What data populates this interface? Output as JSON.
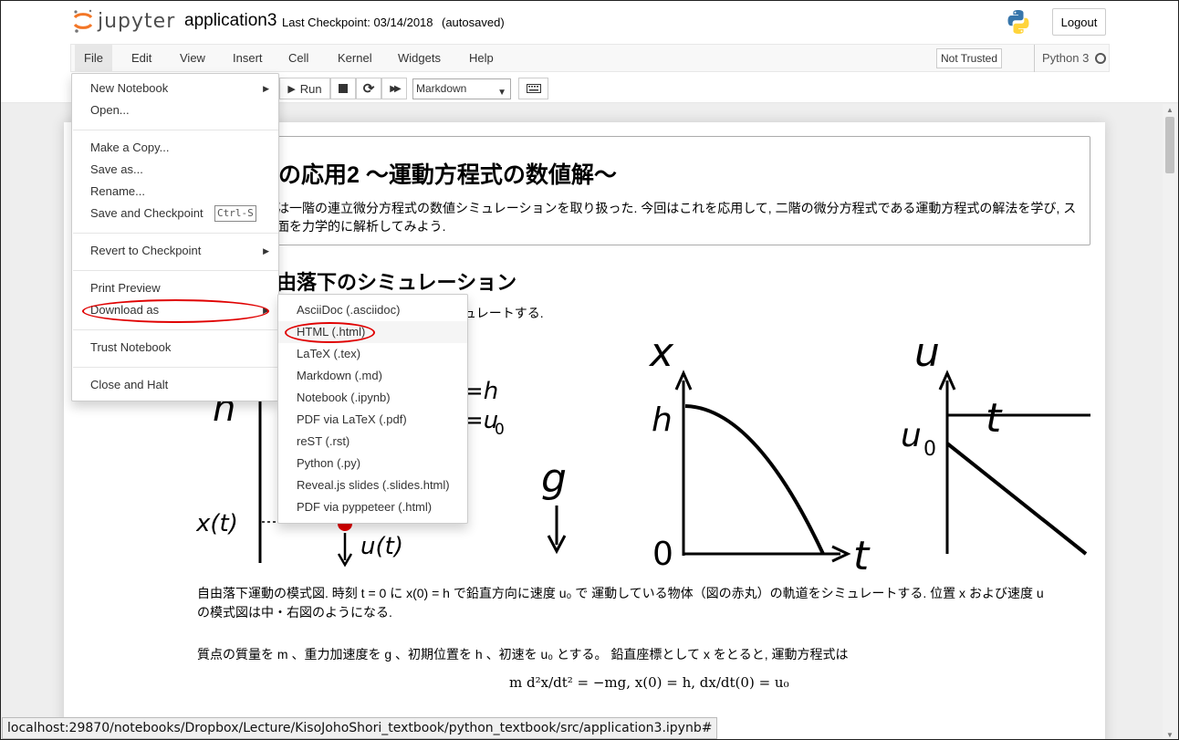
{
  "header": {
    "logo_text": "jupyter",
    "notebook_name": "application3",
    "checkpoint": "Last Checkpoint: 03/14/2018",
    "autosave": "(autosaved)",
    "logout_label": "Logout"
  },
  "menubar": {
    "items": [
      "File",
      "Edit",
      "View",
      "Insert",
      "Cell",
      "Kernel",
      "Widgets",
      "Help"
    ],
    "trust_badge": "Not Trusted",
    "kernel_name": "Python 3"
  },
  "toolbar": {
    "run_label": "Run",
    "cell_type": "Markdown"
  },
  "file_menu": {
    "items": [
      "New Notebook",
      "Open...",
      "Make a Copy...",
      "Save as...",
      "Rename...",
      "Save and Checkpoint",
      "Revert to Checkpoint",
      "Print Preview",
      "Download as",
      "Trust Notebook",
      "Close and Halt"
    ],
    "save_shortcut": "Ctrl-S"
  },
  "download_menu": {
    "items": [
      "AsciiDoc (.asciidoc)",
      "HTML (.html)",
      "LaTeX (.tex)",
      "Markdown (.md)",
      "Notebook (.ipynb)",
      "PDF via LaTeX (.pdf)",
      "reST (.rst)",
      "Python (.py)",
      "Reveal.js slides (.slides.html)",
      "PDF via pyppeteer (.html)"
    ]
  },
  "notebook": {
    "title": "の応用2 〜運動方程式の数値解〜",
    "intro_line1": "は一階の連立微分方程式の数値シミュレーションを取り扱った. 今回はこれを応用して, 二階の微分方程式である運動方程式の解法を学び, ス",
    "intro_line2": "面を力学的に解析してみよう.",
    "section_title": "由落下のシミュレーション",
    "section_intro": "ュレートする.",
    "figure_labels": {
      "h": "h",
      "eq_h": "=h",
      "eq_u0": "=u",
      "g": "g",
      "x_t": "x(t)",
      "u_t": "u(t)",
      "x_axis_x": "x",
      "x_axis_h": "h",
      "x_axis_zero": "0",
      "x_axis_t": "t",
      "u_axis_u": "u",
      "u_axis_u0": "u",
      "u_axis_t": "t",
      "sub0": "0"
    },
    "caption_line1": "自由落下運動の模式図. 時刻 t = 0 に x(0) = h で鉛直方向に速度 u₀ で 運動している物体（図の赤丸）の軌道をシミュレートする. 位置 x および速度 u",
    "caption_line2": "の模式図は中・右図のようになる.",
    "paragraph2": "質点の質量を m 、重力加速度を g 、初期位置を h 、初速を u₀ とする。 鉛直座標として x をとると, 運動方程式は",
    "equation": "m d²x/dt² = −mg,    x(0) = h,    dx/dt(0) = u₀"
  },
  "status_bar": "localhost:29870/notebooks/Dropbox/Lecture/KisoJohoShori_textbook/python_textbook/src/application3.ipynb#",
  "colors": {
    "accent_orange": "#f37626",
    "highlight_red": "#e00000",
    "python_blue": "#3776ab",
    "python_yellow": "#ffd43b"
  }
}
